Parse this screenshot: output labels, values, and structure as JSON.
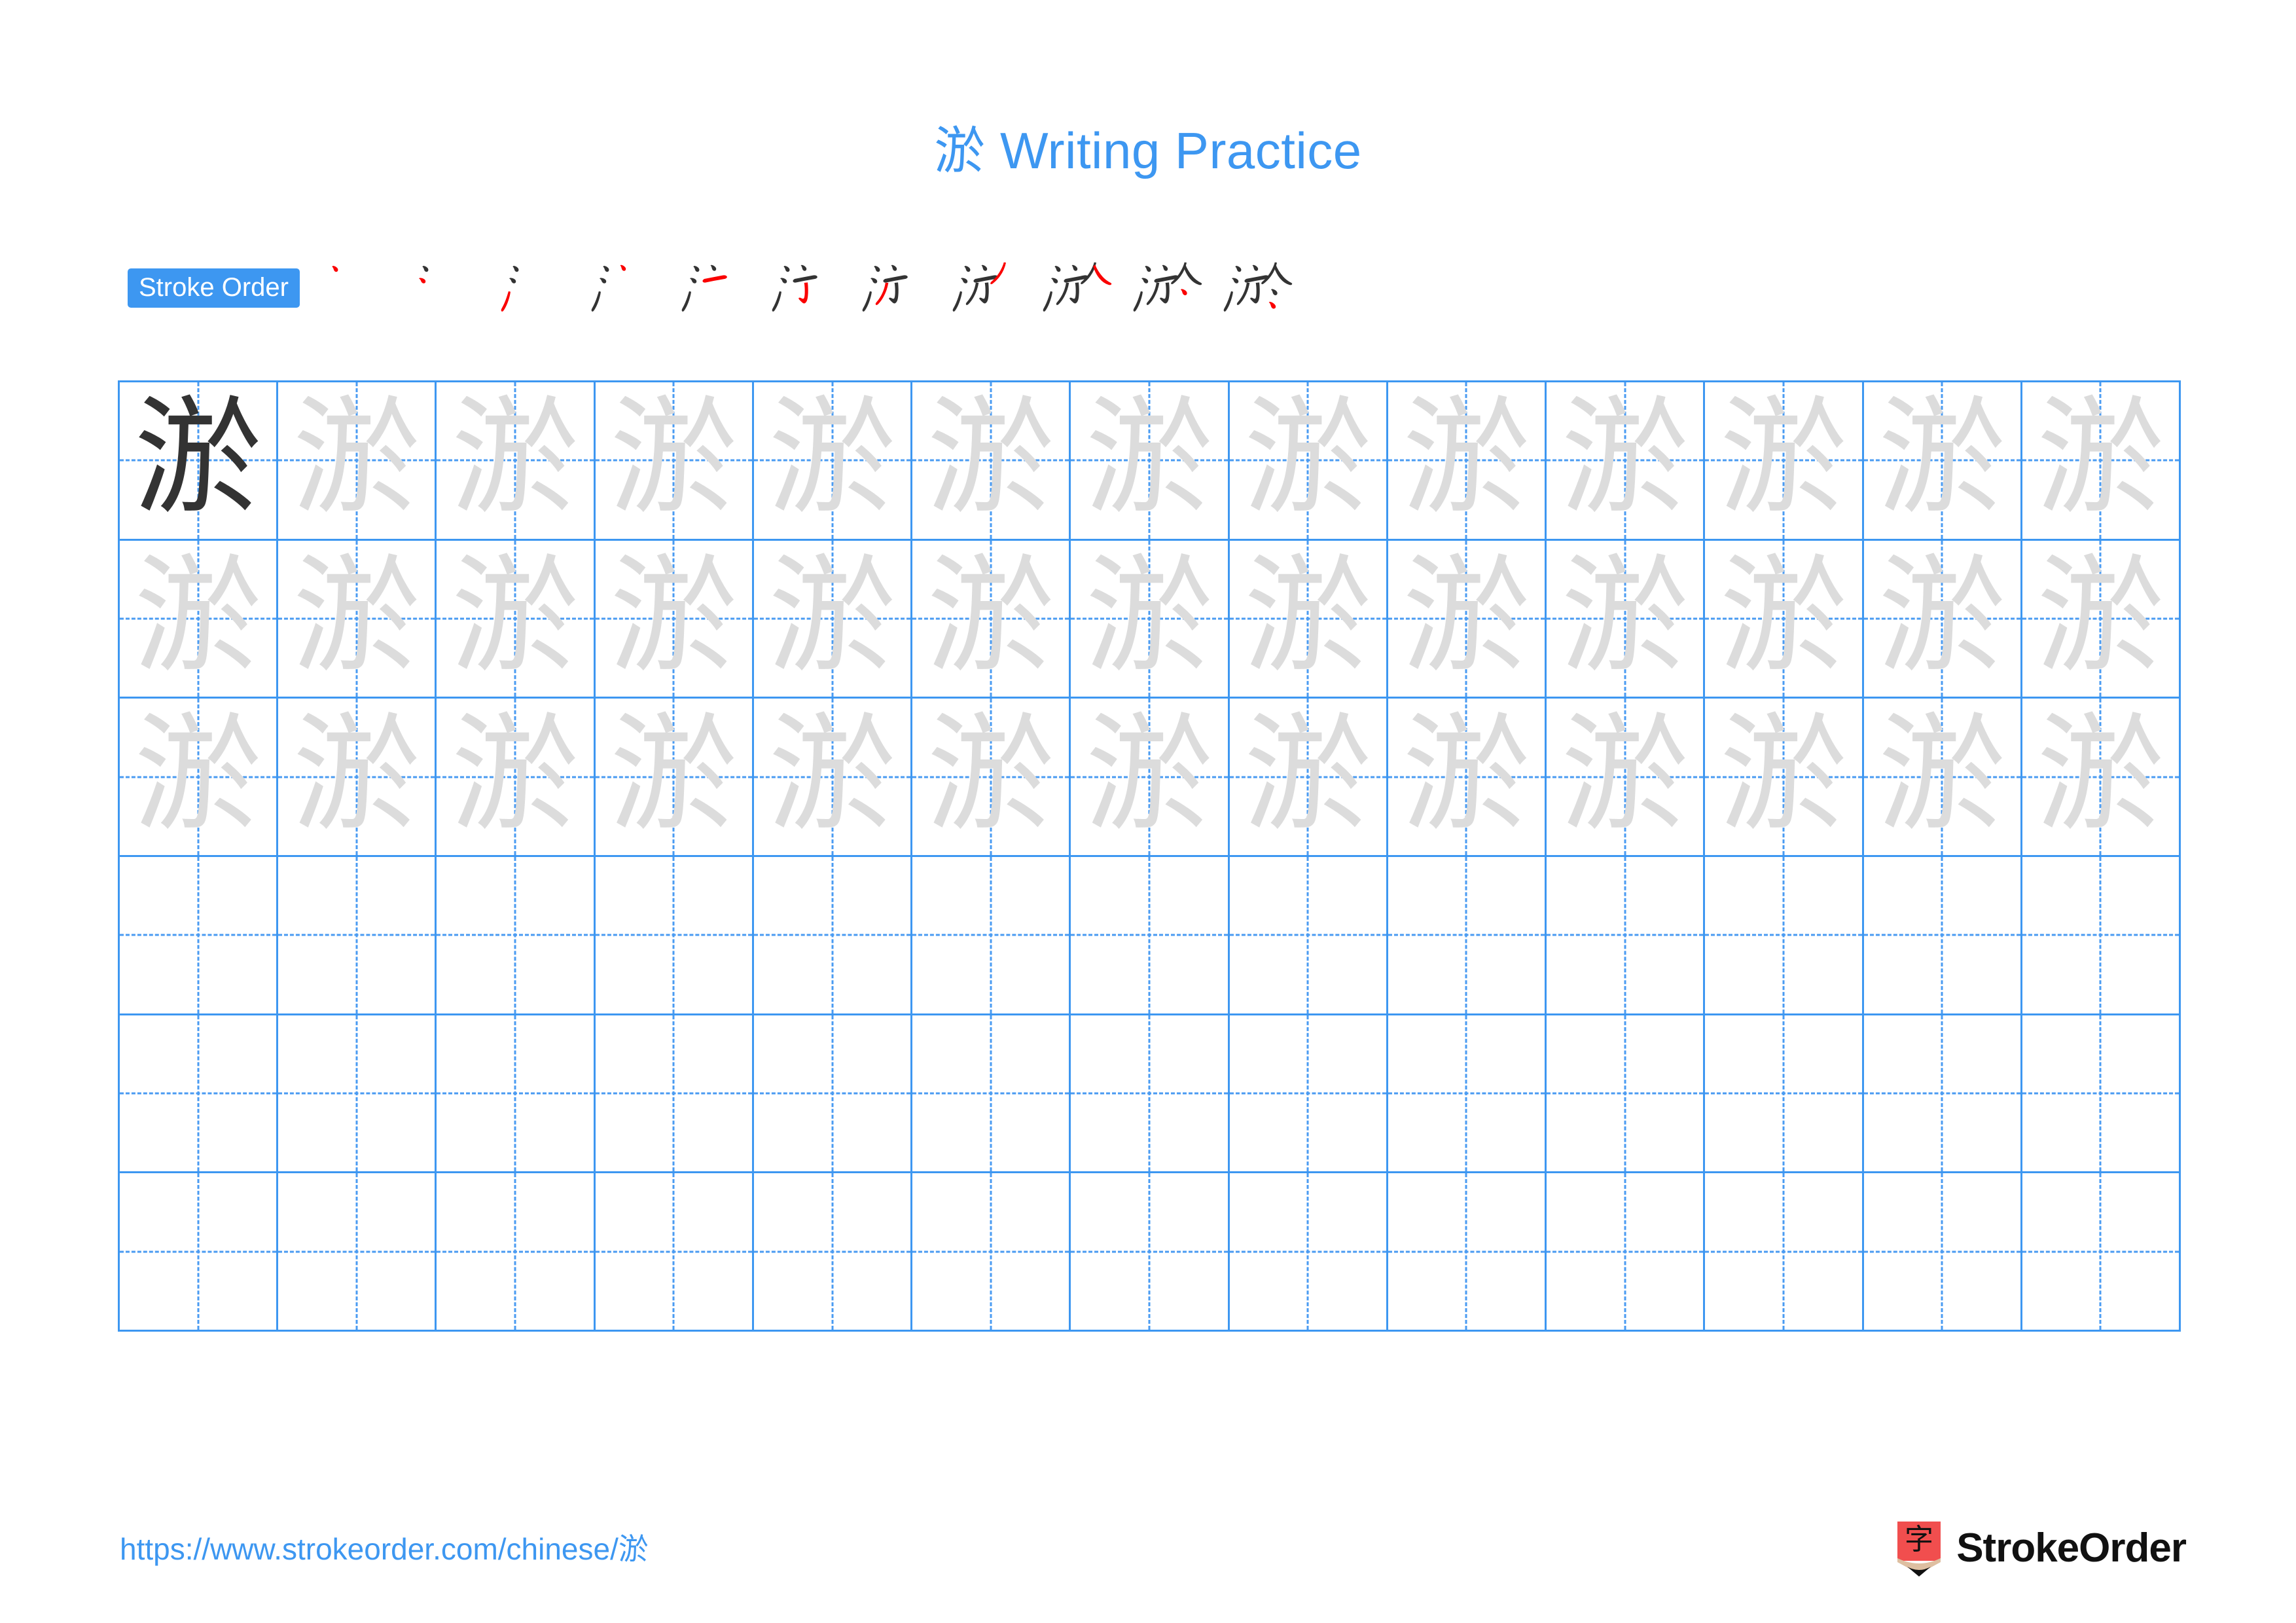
{
  "page": {
    "character": "淤",
    "title": "淤 Writing Practice",
    "background_color": "#ffffff",
    "accent_color": "#3d97f1"
  },
  "stroke_order": {
    "badge_label": "Stroke Order",
    "total_strokes": 11,
    "new_stroke_color": "#fa0000",
    "prior_stroke_color": "#333333",
    "steps": [
      {
        "index": 1,
        "strokes_drawn": 1,
        "new_stroke": "dot (点)"
      },
      {
        "index": 2,
        "strokes_drawn": 2,
        "new_stroke": "dot (点)"
      },
      {
        "index": 3,
        "strokes_drawn": 3,
        "new_stroke": "rising stroke (提)"
      },
      {
        "index": 4,
        "strokes_drawn": 4,
        "new_stroke": "dot (点)"
      },
      {
        "index": 5,
        "strokes_drawn": 5,
        "new_stroke": "horizontal (横)"
      },
      {
        "index": 6,
        "strokes_drawn": 6,
        "new_stroke": "horizontal-fold-hook (横折钩)"
      },
      {
        "index": 7,
        "strokes_drawn": 7,
        "new_stroke": "left-falling (撇)"
      },
      {
        "index": 8,
        "strokes_drawn": 8,
        "new_stroke": "left-falling (撇)"
      },
      {
        "index": 9,
        "strokes_drawn": 9,
        "new_stroke": "right-falling (捺)"
      },
      {
        "index": 10,
        "strokes_drawn": 10,
        "new_stroke": "dot (点)"
      },
      {
        "index": 11,
        "strokes_drawn": 11,
        "new_stroke": "dot (点)"
      }
    ]
  },
  "practice_grid": {
    "columns": 13,
    "rows": 6,
    "grid_line_color": "#3d97f1",
    "guide_line_color": "#4a9bf2",
    "model_char_color": "#333333",
    "trace_char_color": "#dcdcdc",
    "row_fill": [
      {
        "row": 1,
        "mode": "model-then-trace",
        "filled_cells": 13
      },
      {
        "row": 2,
        "mode": "trace",
        "filled_cells": 13
      },
      {
        "row": 3,
        "mode": "trace",
        "filled_cells": 13
      },
      {
        "row": 4,
        "mode": "empty",
        "filled_cells": 0
      },
      {
        "row": 5,
        "mode": "empty",
        "filled_cells": 0
      },
      {
        "row": 6,
        "mode": "empty",
        "filled_cells": 0
      }
    ]
  },
  "footer": {
    "url": "https://www.strokeorder.com/chinese/淤",
    "brand_name": "StrokeOrder",
    "logo_char": "字",
    "logo_body_color": "#f14e4e",
    "logo_wood_color": "#debfa1",
    "logo_tip_color": "#111111"
  }
}
